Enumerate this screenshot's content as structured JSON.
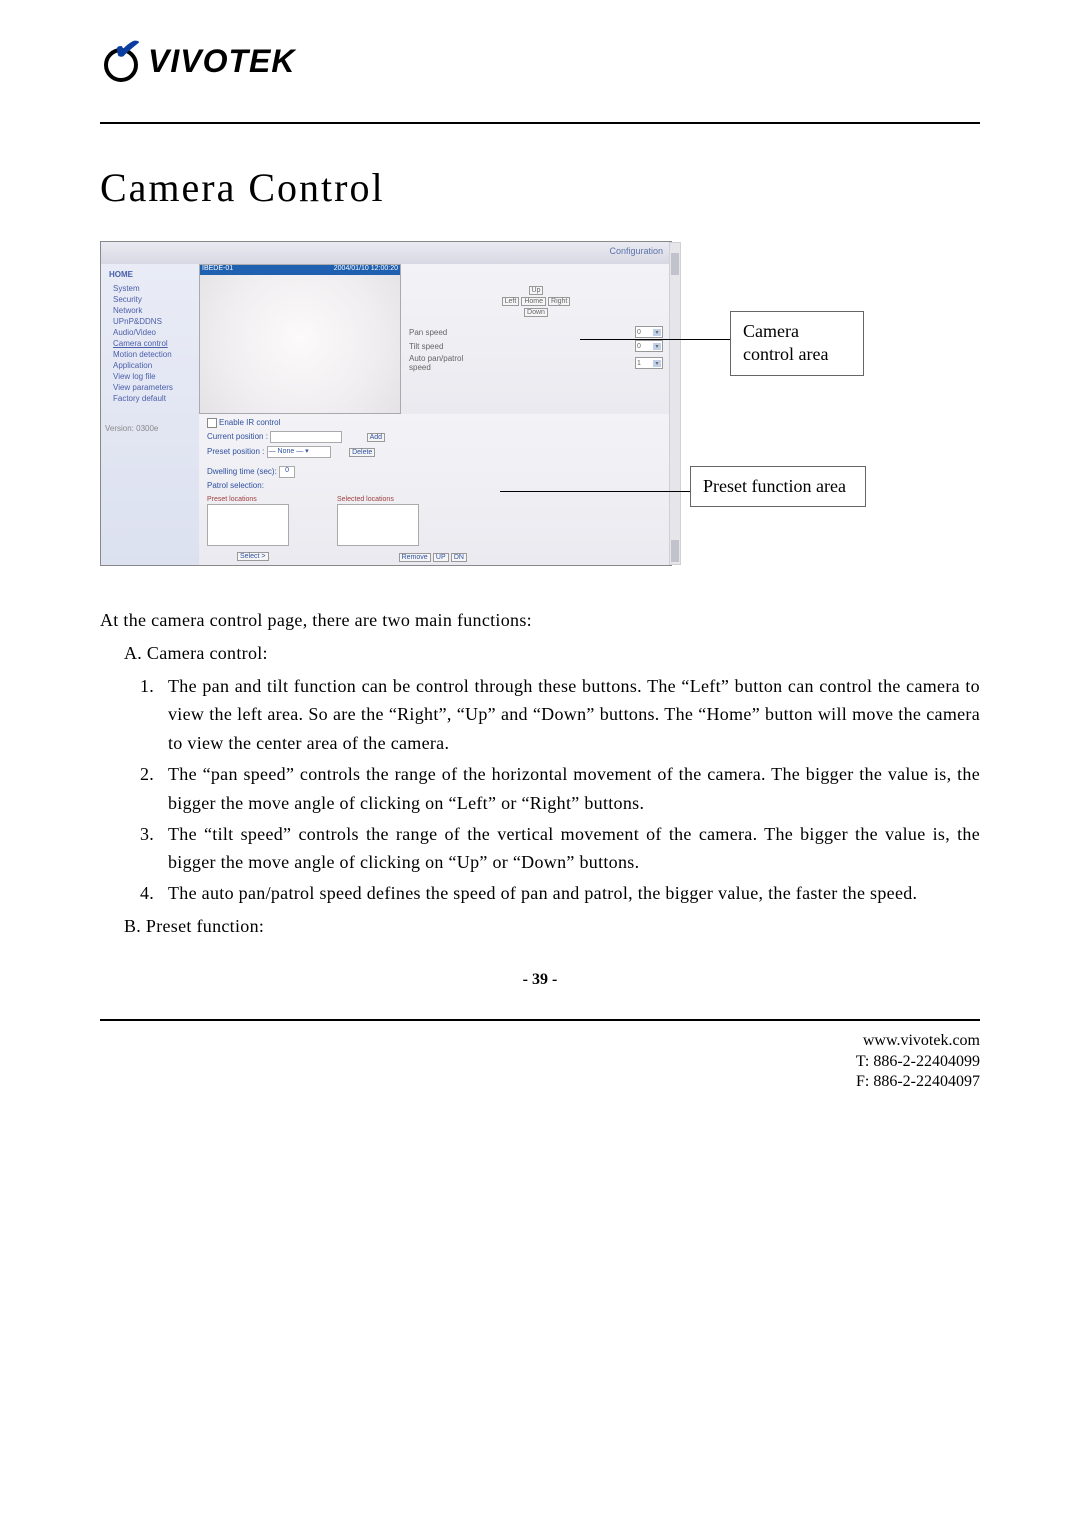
{
  "brand": {
    "name": "VIVOTEK"
  },
  "title": "Camera Control",
  "screenshot": {
    "config_header": "Configuration",
    "sidebar": {
      "home": "HOME",
      "items": [
        "System",
        "Security",
        "Network",
        "UPnP&DDNS",
        "Audio/Video",
        "Camera control",
        "Motion detection",
        "Application",
        "View log file",
        "View parameters",
        "Factory default"
      ],
      "version": "Version: 0300e"
    },
    "video": {
      "title_left": "IBEDE-01",
      "title_right": "2004/01/10 12:00:20"
    },
    "controls": {
      "up": "Up",
      "left": "Left",
      "home": "Home",
      "right": "Right",
      "down": "Down",
      "pan_label": "Pan speed",
      "pan_value": "0",
      "tilt_label": "Tilt speed",
      "tilt_value": "0",
      "auto_label": "Auto pan/patrol speed",
      "auto_value": "1"
    },
    "preset": {
      "enable_label": "Enable IR control",
      "current_label": "Current position :",
      "add": "Add",
      "preset_label": "Preset position :",
      "preset_value": "— None —",
      "delete": "Delete",
      "dwell_label": "Dwelling time (sec):",
      "dwell_value": "0",
      "patrol_label": "Patrol selection:",
      "col_preset": "Preset locations",
      "col_selected": "Selected locations",
      "select_btn": "Select >",
      "remove_btn": "Remove",
      "up_btn": "UP",
      "dn_btn": "DN"
    }
  },
  "callouts": {
    "camera_area": "Camera control area",
    "preset_area": "Preset function area"
  },
  "body": {
    "intro": "At the camera control page, there are two main functions:",
    "a_label": "A.  Camera control:",
    "a_items": [
      "The pan and tilt function can be control through these buttons. The “Left” button can control the camera to view the left area. So are the “Right”, “Up” and “Down” buttons. The “Home” button will move the camera to view the center area of the camera.",
      "The “pan speed” controls the range of the horizontal movement of the camera. The bigger the value is, the bigger the move angle of clicking on “Left” or “Right” buttons.",
      "The “tilt speed” controls the range of the vertical movement of the camera. The bigger the value is, the bigger the move angle of clicking on “Up” or “Down” buttons.",
      "The auto pan/patrol speed defines the speed of pan and patrol, the bigger value, the faster the speed."
    ],
    "b_label": "B.  Preset function:"
  },
  "page_number": "- 39 -",
  "footer": {
    "url": "www.vivotek.com",
    "tel": "T: 886-2-22404099",
    "fax": "F: 886-2-22404097"
  }
}
